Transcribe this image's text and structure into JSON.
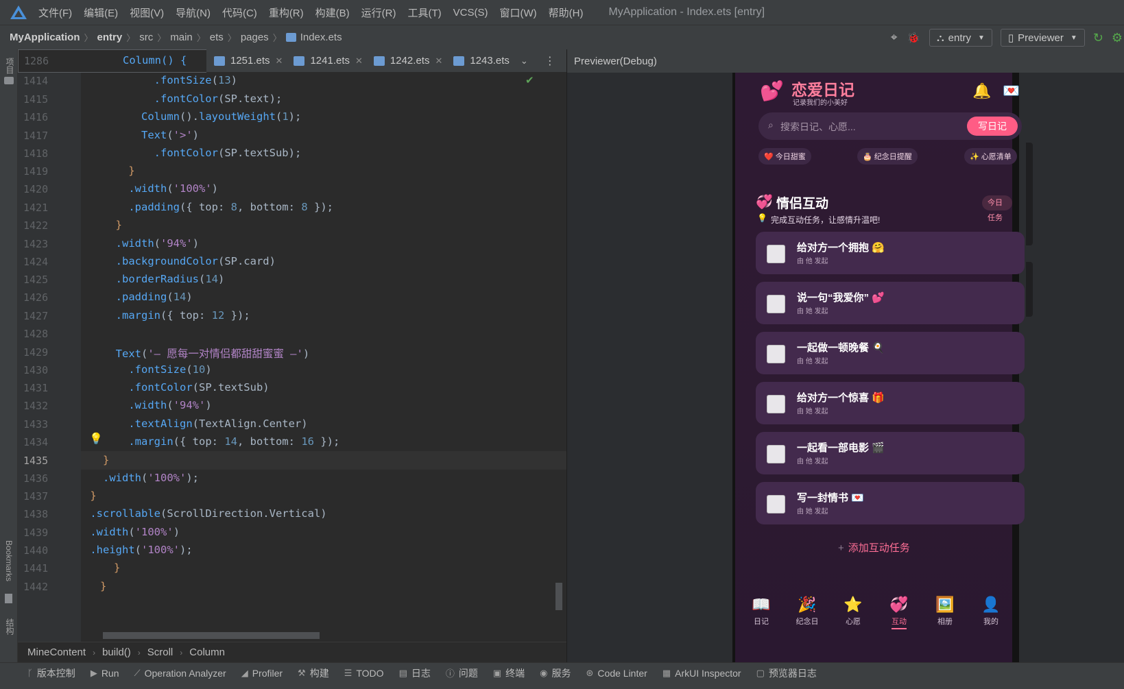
{
  "menubar": {
    "items": [
      "文件(F)",
      "编辑(E)",
      "视图(V)",
      "导航(N)",
      "代码(C)",
      "重构(R)",
      "构建(B)",
      "运行(R)",
      "工具(T)",
      "VCS(S)",
      "窗口(W)",
      "帮助(H)"
    ],
    "title": "MyApplication - Index.ets [entry]"
  },
  "breadcrumb": {
    "items": [
      "MyApplication",
      "entry",
      "src",
      "main",
      "ets",
      "pages",
      "Index.ets"
    ],
    "entry_combo": "entry",
    "previewer_combo": "Previewer"
  },
  "leftstrip": {
    "project": "项目",
    "bookmarks": "Bookmarks",
    "structure": "结构"
  },
  "tabs": {
    "sticky_line": "1286",
    "sticky_code": "Column() {",
    "files": [
      "1251.ets",
      "1241.ets",
      "1242.ets",
      "1243.ets"
    ]
  },
  "editor": {
    "lines": [
      {
        "n": "1414"
      },
      {
        "n": "1415"
      },
      {
        "n": "1416"
      },
      {
        "n": "1417"
      },
      {
        "n": "1418"
      },
      {
        "n": "1419"
      },
      {
        "n": "1420"
      },
      {
        "n": "1421"
      },
      {
        "n": "1422"
      },
      {
        "n": "1423"
      },
      {
        "n": "1424"
      },
      {
        "n": "1425"
      },
      {
        "n": "1426"
      },
      {
        "n": "1427"
      },
      {
        "n": "1428"
      },
      {
        "n": "1429"
      },
      {
        "n": "1430"
      },
      {
        "n": "1431"
      },
      {
        "n": "1432"
      },
      {
        "n": "1433"
      },
      {
        "n": "1434"
      },
      {
        "n": "1435"
      },
      {
        "n": "1436"
      },
      {
        "n": "1437"
      },
      {
        "n": "1438"
      },
      {
        "n": "1439"
      },
      {
        "n": "1440"
      },
      {
        "n": "1441"
      },
      {
        "n": "1442"
      }
    ],
    "current_line": "1435"
  },
  "code_crumb": [
    "MineContent",
    "build()",
    "Scroll",
    "Column"
  ],
  "toolwindows": [
    "版本控制",
    "Run",
    "Operation Analyzer",
    "Profiler",
    "构建",
    "TODO",
    "日志",
    "问题",
    "终端",
    "服务",
    "Code Linter",
    "ArkUI Inspector",
    "预览器日志"
  ],
  "previewer": {
    "title": "Previewer(Debug)",
    "app": {
      "title": "恋爱日记",
      "subtitle": "记录我们的小美好",
      "search_placeholder": "搜索日记、心愿...",
      "write_button": "写日记",
      "chips": [
        "❤️ 今日甜蜜",
        "🎂 纪念日提醒",
        "✨ 心愿清单"
      ],
      "section_title": "情侣互动",
      "section_badge": "今日任务",
      "section_sub": "完成互动任务，让感情升温吧!",
      "tasks": [
        {
          "title": "给对方一个拥抱 🤗",
          "by": "由 他 发起"
        },
        {
          "title": "说一句“我爱你” 💕",
          "by": "由 她 发起"
        },
        {
          "title": "一起做一顿晚餐 🍳",
          "by": "由 他 发起"
        },
        {
          "title": "给对方一个惊喜 🎁",
          "by": "由 她 发起"
        },
        {
          "title": "一起看一部电影 🎬",
          "by": "由 他 发起"
        },
        {
          "title": "写一封情书 💌",
          "by": "由 她 发起"
        }
      ],
      "add_task": "添加互动任务",
      "tabs": [
        {
          "icon": "📖",
          "label": "日记"
        },
        {
          "icon": "🎉",
          "label": "纪念日"
        },
        {
          "icon": "⭐",
          "label": "心愿"
        },
        {
          "icon": "💞",
          "label": "互动"
        },
        {
          "icon": "🖼️",
          "label": "相册"
        },
        {
          "icon": "👤",
          "label": "我的"
        }
      ]
    }
  }
}
